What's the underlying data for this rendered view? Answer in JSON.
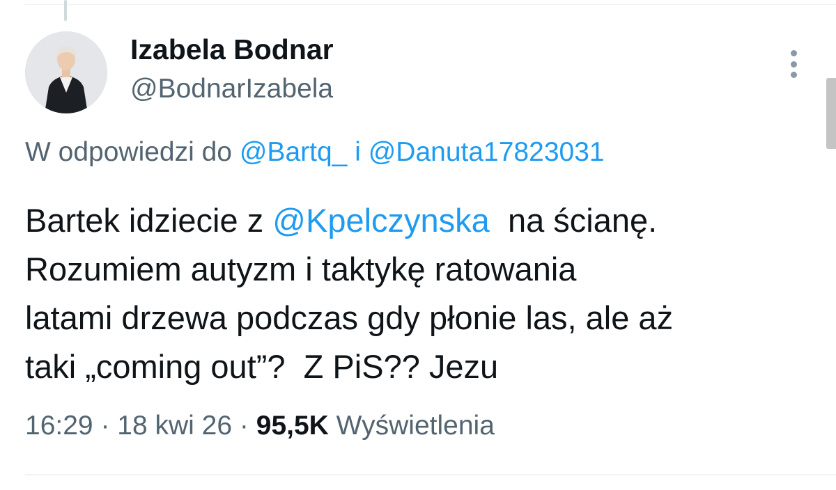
{
  "author": {
    "display_name": "Izabela Bodnar",
    "handle": "@BodnarIzabela"
  },
  "reply": {
    "prefix": "W odpowiedzi do",
    "mention_1": "@Bartq_",
    "joiner": "i",
    "mention_2": "@Danuta17823031"
  },
  "tweet": {
    "line1_before": "Bartek idziecie z ",
    "line1_mention": "@Kpelczynska",
    "line1_after": "  na ścianę.",
    "line2": "Rozumiem autyzm i taktykę ratowania",
    "line3": "latami drzewa podczas gdy płonie las, ale aż",
    "line4": "taki „coming out”?  Z PiS?? Jezu"
  },
  "meta": {
    "time": "16:29",
    "separator": "·",
    "date": "18 kwi 26",
    "views_count": "95,5K",
    "views_label": "Wyświetlenia"
  },
  "icons": {
    "more": "more-horizontal-icon"
  },
  "colors": {
    "link": "#1d9bf0",
    "secondary_text": "#536471",
    "primary_text": "#0f1419"
  }
}
